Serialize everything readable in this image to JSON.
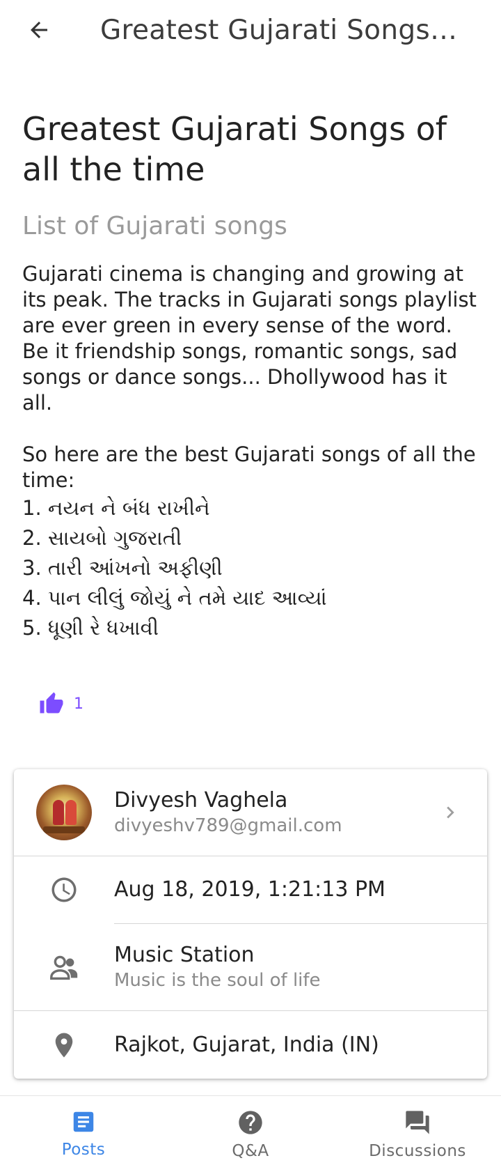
{
  "appbar": {
    "title": "Greatest Gujarati Songs of all the time",
    "back_icon": "arrow-back-icon"
  },
  "post": {
    "title": "Greatest Gujarati Songs of all the time",
    "subtitle": "List of Gujarati songs",
    "intro": " Gujarati cinema is changing and growing at its peak. The tracks in Gujarati songs playlist are ever green in every sense of the word. Be it friendship songs, romantic songs, sad songs or dance songs... Dhollywood has it all.",
    "lead_in": "So here are the best Gujarati songs of all the time:",
    "songs": [
      "1. નયન ને બંધ રાખીને",
      "2. સાયબો ગુજરાતી",
      "3. તારી આંખનો અફીણી",
      "4. પાન લીલું જોયું ને તમે યાદ આવ્યાં",
      "5. ધૂણી રે ધખાવી"
    ]
  },
  "likes": {
    "count": "1",
    "icon": "thumb-up-icon",
    "color": "#7c4dff"
  },
  "details": {
    "author": {
      "name": "Divyesh Vaghela",
      "email": "divyeshv789@gmail.com",
      "icon": "chevron-right-icon"
    },
    "timestamp": {
      "value": "Aug 18, 2019, 1:21:13 PM",
      "icon": "clock-icon"
    },
    "group": {
      "name": "Music Station",
      "tagline": "Music is the soul of life",
      "icon": "group-icon"
    },
    "location": {
      "value": "Rajkot, Gujarat, India (IN)",
      "icon": "location-pin-icon"
    }
  },
  "bottom_nav": {
    "items": [
      {
        "label": "Posts",
        "icon": "posts-icon",
        "active": true
      },
      {
        "label": "Q&A",
        "icon": "help-icon",
        "active": false
      },
      {
        "label": "Discussions",
        "icon": "forum-icon",
        "active": false
      }
    ],
    "active_color": "#3d86e6",
    "inactive_color": "#6b6b6b"
  }
}
